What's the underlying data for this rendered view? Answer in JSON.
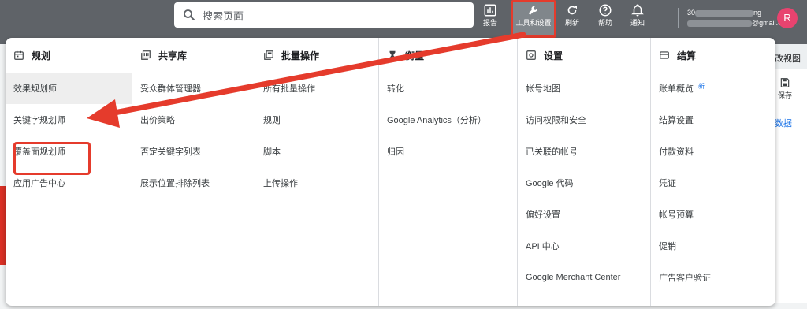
{
  "topbar": {
    "search_placeholder": "搜索页面",
    "report_label": "报告",
    "tools_label": "工具和设置",
    "refresh_label": "刷新",
    "help_label": "帮助",
    "notify_label": "通知",
    "account_line1": "30",
    "account_line1_tail": "ng",
    "account_email": "@gmail.com",
    "avatar_letter": "R"
  },
  "background": {
    "strip_text": "改视图",
    "save_label": "保存",
    "data_link": "数据"
  },
  "columns": [
    {
      "title": "规划",
      "icon": "calendar-icon",
      "items": [
        "效果规划师",
        "关键字规划师",
        "覆盖面规划师",
        "应用广告中心"
      ]
    },
    {
      "title": "共享库",
      "icon": "library-icon",
      "items": [
        "受众群体管理器",
        "出价策略",
        "否定关键字列表",
        "展示位置排除列表"
      ]
    },
    {
      "title": "批量操作",
      "icon": "bulk-icon",
      "items": [
        "所有批量操作",
        "规则",
        "脚本",
        "上传操作"
      ]
    },
    {
      "title": "衡量",
      "icon": "hourglass-icon",
      "items": [
        "转化",
        "Google Analytics（分析）",
        "归因"
      ]
    },
    {
      "title": "设置",
      "icon": "settings-icon",
      "items": [
        "帐号地图",
        "访问权限和安全",
        "已关联的帐号",
        "Google 代码",
        "偏好设置",
        "API 中心",
        "Google Merchant Center"
      ]
    },
    {
      "title": "结算",
      "icon": "card-icon",
      "items": [
        "账单概览",
        "结算设置",
        "付款资料",
        "凭证",
        "帐号预算",
        "促销",
        "广告客户验证"
      ],
      "badge": "新"
    }
  ],
  "colors": {
    "highlight_red": "#e53b2c",
    "topbar": "#5f6368",
    "link_blue": "#1a73e8"
  }
}
